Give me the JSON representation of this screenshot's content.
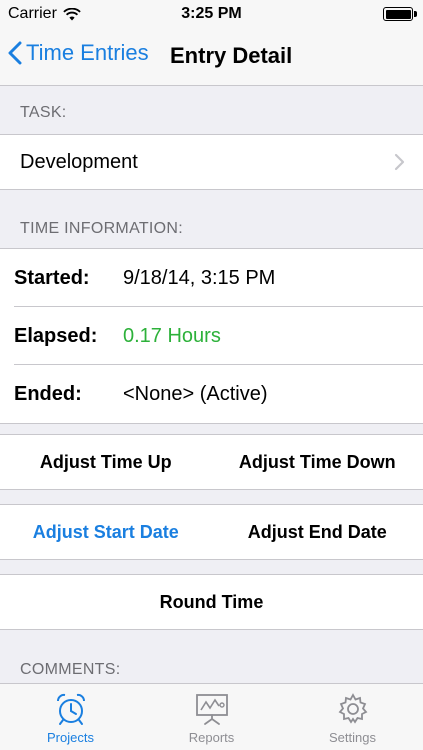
{
  "status": {
    "carrier": "Carrier",
    "time": "3:25 PM"
  },
  "nav": {
    "back_label": "Time Entries",
    "title": "Entry Detail"
  },
  "task": {
    "header": "TASK:",
    "value": "Development"
  },
  "time_info": {
    "header": "TIME INFORMATION:",
    "started_label": "Started:",
    "started_value": "9/18/14, 3:15 PM",
    "elapsed_label": "Elapsed:",
    "elapsed_value": "0.17 Hours",
    "ended_label": "Ended:",
    "ended_value": "<None>  (Active)"
  },
  "buttons": {
    "adjust_up": "Adjust Time Up",
    "adjust_down": "Adjust Time Down",
    "adjust_start": "Adjust Start Date",
    "adjust_end": "Adjust End Date",
    "round": "Round Time"
  },
  "comments": {
    "header": "COMMENTS:"
  },
  "tabs": [
    {
      "label": "Projects",
      "icon": "alarm-clock-icon",
      "active": true
    },
    {
      "label": "Reports",
      "icon": "chart-board-icon",
      "active": false
    },
    {
      "label": "Settings",
      "icon": "gear-icon",
      "active": false
    }
  ],
  "colors": {
    "accent": "#1a7fe0",
    "elapsed": "#2db13a"
  }
}
